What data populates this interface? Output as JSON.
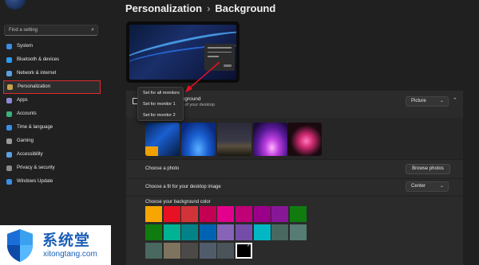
{
  "sidebar": {
    "search_placeholder": "Find a setting",
    "items": [
      {
        "label": "System",
        "color": "#3a8ee6"
      },
      {
        "label": "Bluetooth & devices",
        "color": "#2a9df4"
      },
      {
        "label": "Network & internet",
        "color": "#5aa0e0"
      },
      {
        "label": "Personalization",
        "color": "#c9a24a"
      },
      {
        "label": "Apps",
        "color": "#8a8ad8"
      },
      {
        "label": "Accounts",
        "color": "#3ab07a"
      },
      {
        "label": "Time & language",
        "color": "#3a8ee6"
      },
      {
        "label": "Gaming",
        "color": "#9a9a9a"
      },
      {
        "label": "Accessibility",
        "color": "#5aa0e0"
      },
      {
        "label": "Privacy & security",
        "color": "#8a8a8a"
      },
      {
        "label": "Windows Update",
        "color": "#3a8ee6"
      }
    ],
    "active_index": 3
  },
  "header": {
    "breadcrumb_parent": "Personalization",
    "breadcrumb_sep": "›",
    "breadcrumb_current": "Background"
  },
  "context_menu": {
    "items": [
      "Set for all monitors",
      "Set for monitor 1",
      "Set for monitor 2"
    ]
  },
  "personalize": {
    "title_partial": "kground",
    "subtitle_partial": "es of your desktop",
    "dropdown_value": "Picture"
  },
  "recent_images": [
    "blue-wave",
    "windows-bloom",
    "desert-night",
    "purple-glow",
    "flower"
  ],
  "choose_photo": {
    "label": "Choose a photo",
    "button": "Browse photos"
  },
  "fit": {
    "label": "Choose a fit for your desktop image",
    "value": "Center"
  },
  "colors": {
    "label": "Choose your background color",
    "row1": [
      "#f7a500",
      "#e81123",
      "#d13438",
      "#c30052",
      "#e3008c",
      "#bf0077",
      "#9a0089",
      "#881798",
      "#107c10"
    ],
    "row2": [
      "#107c10",
      "#00b294",
      "#038387",
      "#0063b1",
      "#8764b8",
      "#744da9",
      "#00b7c3",
      "#486860",
      "#567c73"
    ],
    "row3": [
      "#486860",
      "#7e735f",
      "#4c4a48",
      "#515c6b",
      "#4a5459",
      "#000000"
    ],
    "selected": "#000000"
  },
  "watermark": {
    "chinese": "系统堂",
    "site": "xitongtang.com"
  }
}
